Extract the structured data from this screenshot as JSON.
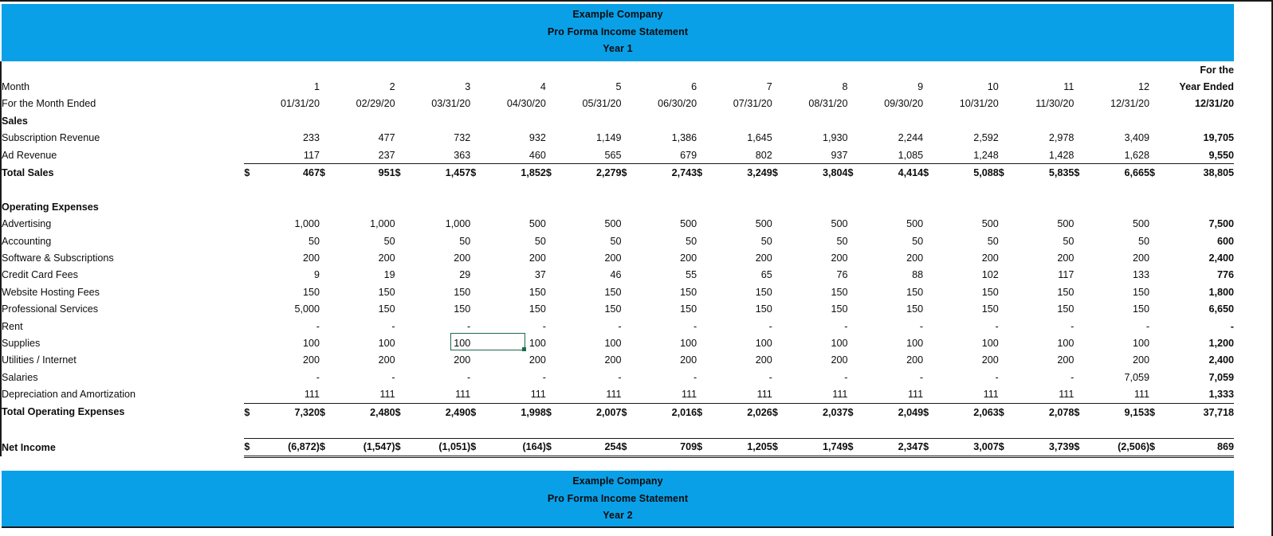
{
  "banner_top": {
    "line1": "Example Company",
    "line2": "Pro Forma Income Statement",
    "line3": "Year 1"
  },
  "banner_bottom": {
    "line1": "Example Company",
    "line2": "Pro Forma Income Statement",
    "line3": "Year 2"
  },
  "colors": {
    "banner_blue": "#09A0E8",
    "selection_green": "#1F6B4B",
    "text": "#0D0D0D"
  },
  "header": {
    "month_label": "Month",
    "month_ended_label": "For the Month Ended",
    "months": [
      "1",
      "2",
      "3",
      "4",
      "5",
      "6",
      "7",
      "8",
      "9",
      "10",
      "11",
      "12"
    ],
    "month_end_dates": [
      "01/31/20",
      "02/29/20",
      "03/31/20",
      "04/30/20",
      "05/31/20",
      "06/30/20",
      "07/31/20",
      "08/31/20",
      "09/30/20",
      "10/31/20",
      "11/30/20",
      "12/31/20"
    ],
    "year_col_line1": "For the",
    "year_col_line2": "Year Ended",
    "year_col_date": "12/31/20"
  },
  "sections": {
    "sales_heading": "Sales",
    "opex_heading": "Operating Expenses"
  },
  "dollar_sign": "$",
  "rows": {
    "subscription_revenue": {
      "label": "Subscription Revenue",
      "values": [
        "233",
        "477",
        "732",
        "932",
        "1,149",
        "1,386",
        "1,645",
        "1,930",
        "2,244",
        "2,592",
        "2,978",
        "3,409"
      ],
      "year": "19,705"
    },
    "ad_revenue": {
      "label": "Ad Revenue",
      "values": [
        "117",
        "237",
        "363",
        "460",
        "565",
        "679",
        "802",
        "937",
        "1,085",
        "1,248",
        "1,428",
        "1,628"
      ],
      "year": "9,550"
    },
    "total_sales": {
      "label": "Total Sales",
      "values": [
        "467",
        "951",
        "1,457",
        "1,852",
        "2,279",
        "2,743",
        "3,249",
        "3,804",
        "4,414",
        "5,088",
        "5,835",
        "6,665"
      ],
      "year": "38,805"
    },
    "advertising": {
      "label": "Advertising",
      "values": [
        "1,000",
        "1,000",
        "1,000",
        "500",
        "500",
        "500",
        "500",
        "500",
        "500",
        "500",
        "500",
        "500"
      ],
      "year": "7,500"
    },
    "accounting": {
      "label": "Accounting",
      "values": [
        "50",
        "50",
        "50",
        "50",
        "50",
        "50",
        "50",
        "50",
        "50",
        "50",
        "50",
        "50"
      ],
      "year": "600"
    },
    "software_subscriptions": {
      "label": "Software & Subscriptions",
      "values": [
        "200",
        "200",
        "200",
        "200",
        "200",
        "200",
        "200",
        "200",
        "200",
        "200",
        "200",
        "200"
      ],
      "year": "2,400"
    },
    "credit_card_fees": {
      "label": "Credit Card Fees",
      "values": [
        "9",
        "19",
        "29",
        "37",
        "46",
        "55",
        "65",
        "76",
        "88",
        "102",
        "117",
        "133"
      ],
      "year": "776"
    },
    "website_hosting_fees": {
      "label": "Website Hosting Fees",
      "values": [
        "150",
        "150",
        "150",
        "150",
        "150",
        "150",
        "150",
        "150",
        "150",
        "150",
        "150",
        "150"
      ],
      "year": "1,800"
    },
    "professional_services": {
      "label": "Professional Services",
      "values": [
        "5,000",
        "150",
        "150",
        "150",
        "150",
        "150",
        "150",
        "150",
        "150",
        "150",
        "150",
        "150"
      ],
      "year": "6,650"
    },
    "rent": {
      "label": "Rent",
      "values": [
        "-",
        "-",
        "-",
        "-",
        "-",
        "-",
        "-",
        "-",
        "-",
        "-",
        "-",
        "-"
      ],
      "year": "-"
    },
    "supplies": {
      "label": "Supplies",
      "values": [
        "100",
        "100",
        "100",
        "100",
        "100",
        "100",
        "100",
        "100",
        "100",
        "100",
        "100",
        "100"
      ],
      "year": "1,200"
    },
    "utilities_internet": {
      "label": "Utilities / Internet",
      "values": [
        "200",
        "200",
        "200",
        "200",
        "200",
        "200",
        "200",
        "200",
        "200",
        "200",
        "200",
        "200"
      ],
      "year": "2,400"
    },
    "salaries": {
      "label": "Salaries",
      "values": [
        "-",
        "-",
        "-",
        "-",
        "-",
        "-",
        "-",
        "-",
        "-",
        "-",
        "-",
        "7,059"
      ],
      "year": "7,059"
    },
    "depreciation_amortization": {
      "label": "Depreciation and Amortization",
      "values": [
        "111",
        "111",
        "111",
        "111",
        "111",
        "111",
        "111",
        "111",
        "111",
        "111",
        "111",
        "111"
      ],
      "year": "1,333"
    },
    "total_operating_expenses": {
      "label": "Total Operating Expenses",
      "values": [
        "7,320",
        "2,480",
        "2,490",
        "1,998",
        "2,007",
        "2,016",
        "2,026",
        "2,037",
        "2,049",
        "2,063",
        "2,078",
        "9,153"
      ],
      "year": "37,718"
    },
    "net_income": {
      "label": "Net Income",
      "values": [
        "(6,872)",
        "(1,547)",
        "(1,051)",
        "(164)",
        "254",
        "709",
        "1,205",
        "1,749",
        "2,347",
        "3,007",
        "3,739",
        "(2,506)"
      ],
      "year": "869"
    }
  },
  "selection": {
    "cell_value": "100",
    "row": "Supplies",
    "column": "4"
  }
}
